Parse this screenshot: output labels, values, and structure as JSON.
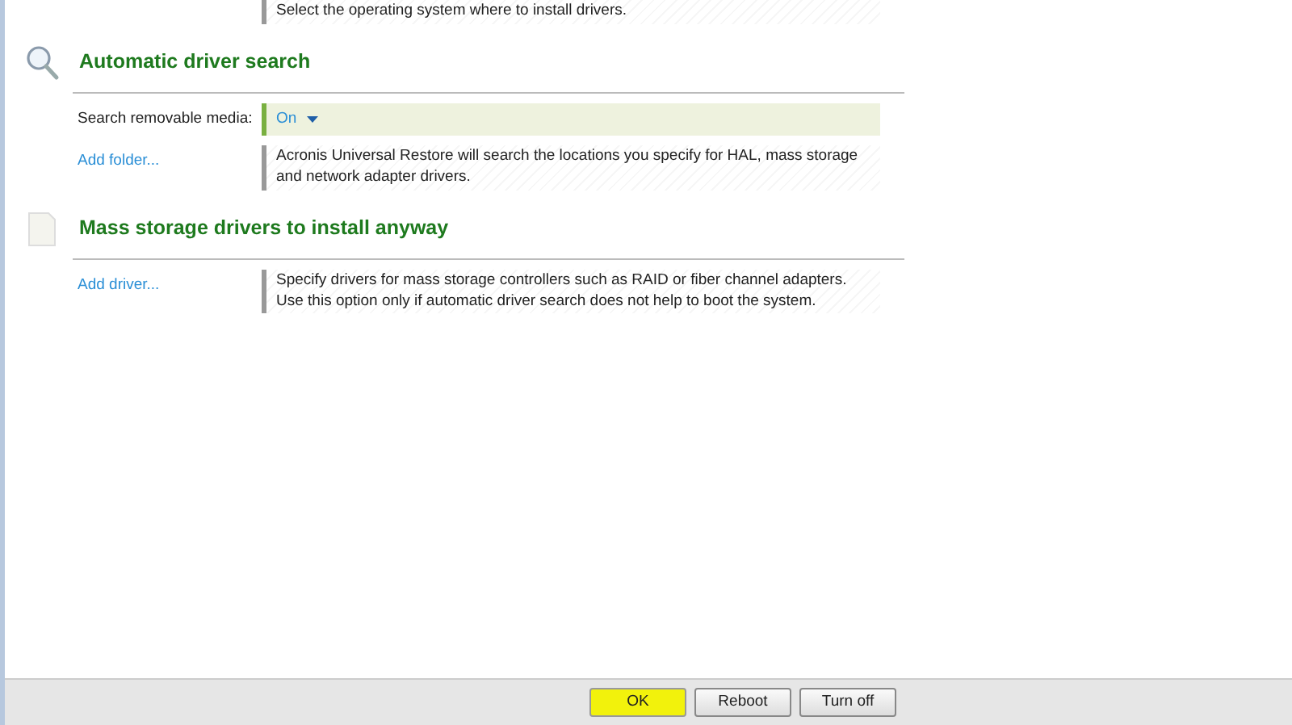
{
  "top_hint": "Select the operating system where to install drivers.",
  "sections": [
    {
      "title": "Automatic driver search",
      "rows": [
        {
          "kind": "dropdown",
          "label": "Search removable media:",
          "value": "On"
        },
        {
          "kind": "link",
          "link": "Add folder...",
          "hint": "Acronis Universal Restore will search the locations you specify for HAL, mass storage and network adapter drivers."
        }
      ]
    },
    {
      "title": "Mass storage drivers to install anyway",
      "rows": [
        {
          "kind": "link",
          "link": "Add driver...",
          "hint": "Specify drivers for mass storage controllers such as RAID or fiber channel adapters. Use this option only if automatic driver search does not help to boot the system."
        }
      ]
    }
  ],
  "buttons": [
    {
      "label": "OK",
      "selected": true
    },
    {
      "label": "Reboot",
      "selected": false
    },
    {
      "label": "Turn off",
      "selected": false
    }
  ]
}
